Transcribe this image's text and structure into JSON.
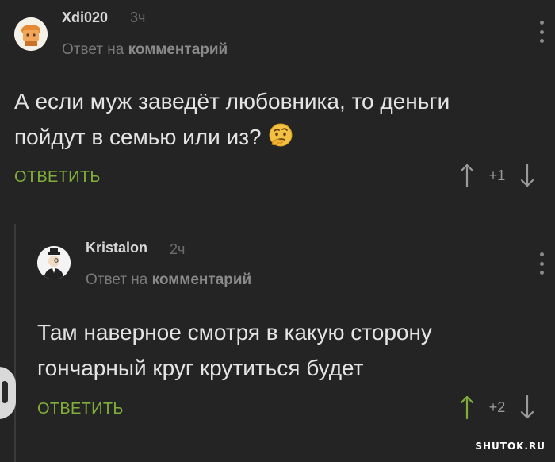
{
  "comments": [
    {
      "username": "Xdi020",
      "time": "3ч",
      "reply_prefix": "Ответ на",
      "reply_target": "комментарий",
      "text": "А если муж заведёт любовника, то деньги пойдут в семью или из?",
      "emoji_icon": "thinking-face-icon",
      "reply_label": "ОТВЕТИТЬ",
      "score": "+1"
    },
    {
      "username": "Kristalon",
      "time": "2ч",
      "reply_prefix": "Ответ на",
      "reply_target": "комментарий",
      "text": "Там наверное смотря в какую сторону гончарный круг крутиться будет",
      "reply_label": "ОТВЕТИТЬ",
      "score": "+2"
    }
  ],
  "colors": {
    "background": "#242424",
    "accent": "#7fae3a",
    "muted": "#7a7a7a"
  },
  "watermark": "SHUTOK.RU"
}
